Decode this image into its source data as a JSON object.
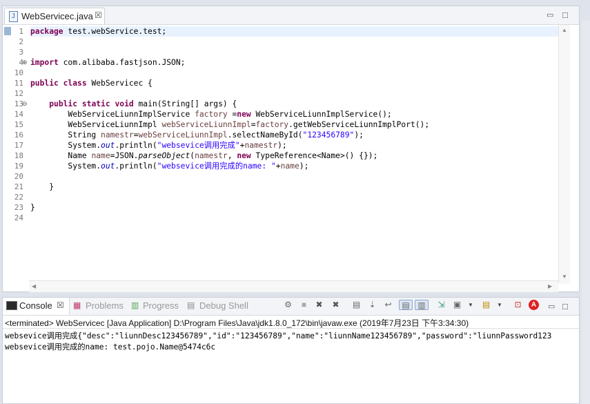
{
  "editor": {
    "tab_title": "WebServicec.java",
    "tab_close": "☒",
    "line_numbers": [
      "1",
      "2",
      "3",
      "4",
      "10",
      "11",
      "12",
      "13",
      "14",
      "15",
      "16",
      "17",
      "18",
      "19",
      "20",
      "21",
      "22",
      "23",
      "24"
    ]
  },
  "code": {
    "l1_kw": "package",
    "l1_rest": " test.webService.test;",
    "l4_kw": "import",
    "l4_rest": " com.alibaba.fastjson.JSON;",
    "l11_kw1": "public",
    "l11_kw2": "class",
    "l11_rest": " WebServicec {",
    "l13_kw1": "public",
    "l13_kw2": "static",
    "l13_kw3": "void",
    "l13_rest": " main(String[] args) {",
    "l14_a": "WebServiceLiunnImplService ",
    "l14_var": "factory",
    "l14_b": " =",
    "l14_kw": "new",
    "l14_c": " WebServiceLiunnImplService();",
    "l15_a": "WebServiceLiunnImpl ",
    "l15_var": "webServiceLiunnImpl",
    "l15_b": "=",
    "l15_var2": "factory",
    "l15_c": ".getWebServiceLiunnImplPort();",
    "l16_a": "String ",
    "l16_var": "namestr",
    "l16_b": "=",
    "l16_var2": "webServiceLiunnImpl",
    "l16_c": ".selectNameById(",
    "l16_str": "\"123456789\"",
    "l16_d": ");",
    "l17_a": "System.",
    "l17_fld": "out",
    "l17_b": ".println(",
    "l17_str": "\"websevice调用完成\"",
    "l17_c": "+",
    "l17_var": "namestr",
    "l17_d": ");",
    "l18_a": "Name ",
    "l18_var": "name",
    "l18_b": "=JSON.",
    "l18_it": "parseObject",
    "l18_c": "(",
    "l18_var2": "namestr",
    "l18_d": ", ",
    "l18_kw": "new",
    "l18_e": " TypeReference<Name>() {});",
    "l19_a": "System.",
    "l19_fld": "out",
    "l19_b": ".println(",
    "l19_str": "\"websevice调用完成的name: \"",
    "l19_c": "+",
    "l19_var": "name",
    "l19_d": ");",
    "l21": "}",
    "l23": "}"
  },
  "console": {
    "tabs": {
      "console": "Console",
      "problems": "Problems",
      "progress": "Progress",
      "debug_shell": "Debug Shell"
    },
    "terminated": "<terminated> WebServicec [Java Application] D:\\Program Files\\Java\\jdk1.8.0_172\\bin\\javaw.exe (2019年7月23日 下午3:34:30)",
    "output_line1": "websevice调用完成{\"desc\":\"liunnDesc123456789\",\"id\":\"123456789\",\"name\":\"liunnName123456789\",\"password\":\"liunnPassword123",
    "output_line2": "websevice调用完成的name: test.pojo.Name@5474c6c"
  },
  "icons": {
    "terminate": "■",
    "remove": "✖",
    "remove_all": "✖",
    "clear": "▤",
    "scroll_lock": "⇣",
    "word_wrap": "↩",
    "pin": "⇲",
    "display": "▣",
    "new_console": "▤",
    "minimize": "▭",
    "maximize": "□"
  }
}
